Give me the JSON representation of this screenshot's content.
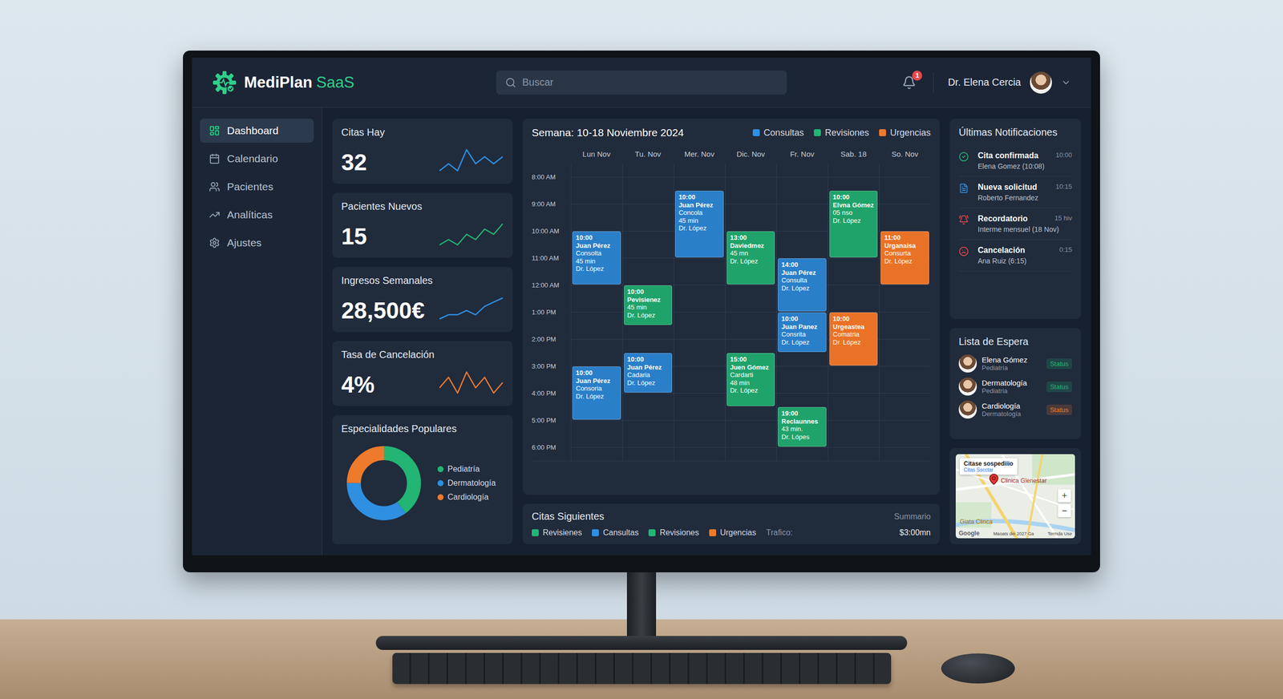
{
  "header": {
    "logo": {
      "name": "MediPlan",
      "suffix": "SaaS"
    },
    "search": {
      "placeholder": "Buscar"
    },
    "notifications_badge": "1",
    "user": {
      "name": "Dr. Elena Cercia"
    }
  },
  "sidebar": {
    "items": [
      {
        "label": "Dashboard",
        "selected": true
      },
      {
        "label": "Calendario",
        "selected": false
      },
      {
        "label": "Pacientes",
        "selected": false
      },
      {
        "label": "Analíticas",
        "selected": false
      },
      {
        "label": "Ajustes",
        "selected": false
      }
    ]
  },
  "stats": [
    {
      "title": "Citas Hay",
      "value": "32",
      "trend": [
        3,
        4,
        3,
        6,
        4,
        5,
        4,
        5
      ],
      "color": "#2f8fe0"
    },
    {
      "title": "Pacientes Nuevos",
      "value": "15",
      "trend": [
        2,
        3,
        2,
        4,
        3,
        5,
        4,
        6
      ],
      "color": "#22b573"
    },
    {
      "title": "Ingresos Semanales",
      "value": "28,500€",
      "trend": [
        2,
        3,
        3,
        4,
        3,
        5,
        6,
        7
      ],
      "color": "#2f8fe0"
    },
    {
      "title": "Tasa de Cancelación",
      "value": "4%",
      "trend": [
        4,
        6,
        3,
        7,
        4,
        6,
        3,
        5
      ],
      "color": "#ee7a2b"
    }
  ],
  "specialties": {
    "title": "Especialidades Populares",
    "segments": [
      {
        "label": "Pediatría",
        "value": 40,
        "color": "#22b573"
      },
      {
        "label": "Dermatología",
        "value": 35,
        "color": "#2f8fe0"
      },
      {
        "label": "Cardiología",
        "value": 25,
        "color": "#ee7a2b"
      }
    ]
  },
  "calendar": {
    "title": "Semana: 10-18 Noviembre 2024",
    "legend": [
      {
        "label": "Consultas",
        "color": "#2f8fe0"
      },
      {
        "label": "Revisiones",
        "color": "#22b573"
      },
      {
        "label": "Urgencias",
        "color": "#ee7a2b"
      }
    ],
    "days": [
      "Lun Nov",
      "Tu. Nov",
      "Mer. Nov",
      "Dic. Nov",
      "Fr. Nov",
      "Sab. 18",
      "So. Nov"
    ],
    "hours": [
      "8:00 AM",
      "9:00 AM",
      "10:00 AM",
      "11:00 AM",
      "12:00 AM",
      "1:00 PM",
      "2:00 PM",
      "3:00 PM",
      "4:00 PM",
      "5:00 PM",
      "6:00 PM"
    ],
    "events": [
      {
        "day": 0,
        "start": 10,
        "end": 12,
        "lines": [
          "10:00",
          "Juan Pérez",
          "Consolta",
          "45 min",
          "Dr. López"
        ],
        "color": "#2a7fc9"
      },
      {
        "day": 0,
        "start": 15,
        "end": 17,
        "lines": [
          "10:00",
          "Juan Pérez",
          "Consoria",
          "Dr. López"
        ],
        "color": "#2a7fc9"
      },
      {
        "day": 1,
        "start": 12,
        "end": 13.5,
        "lines": [
          "10:00",
          "Pevisienez",
          "45 min",
          "Dr. López"
        ],
        "color": "#1fa36a"
      },
      {
        "day": 1,
        "start": 14.5,
        "end": 16,
        "lines": [
          "10:00",
          "Juan Pérez",
          "Cadaria",
          "Dr. López"
        ],
        "color": "#2a7fc9"
      },
      {
        "day": 2,
        "start": 8.5,
        "end": 11,
        "lines": [
          "10:00",
          "Juan Pérez",
          "Concola",
          "45 min",
          "Dr. López"
        ],
        "color": "#2a7fc9"
      },
      {
        "day": 3,
        "start": 10,
        "end": 12,
        "lines": [
          "13:00",
          "Daviedmez",
          "45 mn",
          "Dr. López"
        ],
        "color": "#1fa36a"
      },
      {
        "day": 3,
        "start": 14.5,
        "end": 16.5,
        "lines": [
          "15:00",
          "Juen Gómez",
          "Cardarti",
          "48 min",
          "Dr. López"
        ],
        "color": "#1fa36a"
      },
      {
        "day": 4,
        "start": 11,
        "end": 13,
        "lines": [
          "14:00",
          "Juan Pérez",
          "Consulta",
          "Dr. López"
        ],
        "color": "#2a7fc9"
      },
      {
        "day": 4,
        "start": 13,
        "end": 14.5,
        "lines": [
          "10:00",
          "Juan Panez",
          "Consrita",
          "Dr. López"
        ],
        "color": "#2a7fc9"
      },
      {
        "day": 4,
        "start": 16.5,
        "end": 18,
        "lines": [
          "19:00",
          "Reclaunnes",
          "43 min.",
          "Dr. Lópes"
        ],
        "color": "#1fa36a"
      },
      {
        "day": 5,
        "start": 8.5,
        "end": 11,
        "lines": [
          "10:00",
          "Elvna Gómez",
          "05 nso",
          "Dr. López"
        ],
        "color": "#1fa36a"
      },
      {
        "day": 5,
        "start": 13,
        "end": 15,
        "lines": [
          "10:00",
          "Urgeastea",
          "Comatria",
          "Dr. López"
        ],
        "color": "#ea7226"
      },
      {
        "day": 6,
        "start": 10,
        "end": 12,
        "lines": [
          "11:00",
          "Urganaisa",
          "Consurta",
          "Dr. López"
        ],
        "color": "#ea7226"
      }
    ]
  },
  "upcoming": {
    "title": "Citas Siguientes",
    "summary": "Summario",
    "legend": [
      {
        "label": "Revisienes",
        "color": "#22b573"
      },
      {
        "label": "Cansultas",
        "color": "#2f8fe0"
      },
      {
        "label": "Revisiones",
        "color": "#22b573"
      },
      {
        "label": "Urgencias",
        "color": "#ee7a2b"
      }
    ],
    "traffic_label": "Trafico:",
    "traffic_value": "$3:00mn"
  },
  "notifications": {
    "title": "Últimas Notificaciones",
    "items": [
      {
        "title": "Cita confirmada",
        "time": "10:00",
        "detail": "Elena Gomez (10:08)",
        "kind": "confirmed",
        "color": "#22b573"
      },
      {
        "title": "Nueva solicitud",
        "time": "10:15",
        "detail": "Roberto Fernandez",
        "kind": "request",
        "color": "#2f8fe0"
      },
      {
        "title": "Recordatorio",
        "time": "15 hiv",
        "detail": "Interme mensuel (18 Nov)",
        "kind": "reminder",
        "color": "#e5484d"
      },
      {
        "title": "Cancelación",
        "time": "0:15",
        "detail": "Ana Ruiz (6:15)",
        "kind": "cancel",
        "color": "#e5484d"
      }
    ]
  },
  "waitlist": {
    "title": "Lista de Espera",
    "items": [
      {
        "name": "Elena Gómez",
        "detail": "Pediatría",
        "status": "Status",
        "color": "#22b573"
      },
      {
        "name": "Dermatología",
        "detail": "Pediatria",
        "status": "Status",
        "color": "#22b573"
      },
      {
        "name": "Cardiología",
        "detail": "Dermatología",
        "status": "Status",
        "color": "#ee7a2b"
      }
    ]
  },
  "map": {
    "popup_title": "Citase sospediiio",
    "popup_subtitle": "Citas Sscctar",
    "pin_label": "Clinica Glenestar",
    "place_label": "Giata Clinca",
    "provider": "Google",
    "attribution": "Maoats dei 2027 Ga",
    "terms": "Termda Use",
    "zoom_in": "+",
    "zoom_out": "−"
  }
}
